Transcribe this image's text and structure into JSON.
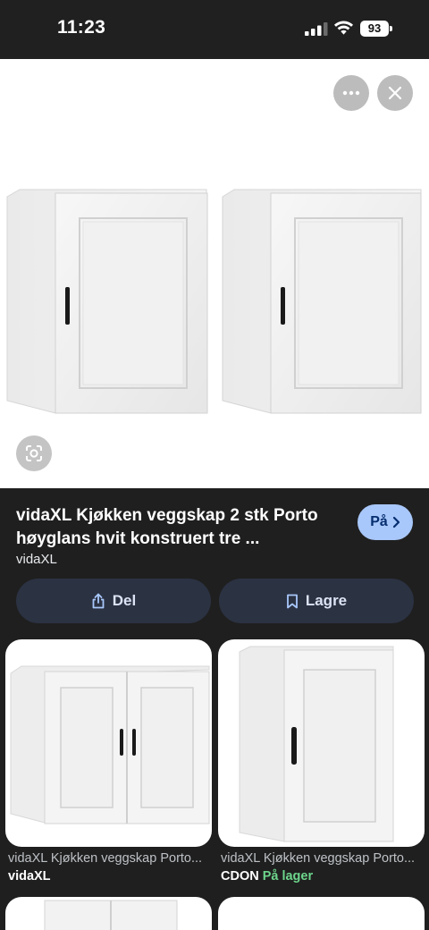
{
  "status_bar": {
    "time": "11:23",
    "battery": "93"
  },
  "hero": {
    "more_icon": "more-horiz-icon",
    "close_icon": "close-icon",
    "lens_icon": "lens-icon"
  },
  "product": {
    "title_line1": "vidaXL Kjøkken veggskap 2 stk Porto",
    "title_line2": "høyglans hvit konstruert tre ...",
    "source": "vidaXL",
    "visit_label": "På"
  },
  "actions": {
    "share_label": "Del",
    "save_label": "Lagre"
  },
  "related": [
    {
      "title": "vidaXL Kjøkken veggskap Porto...",
      "seller": "vidaXL",
      "stock": ""
    },
    {
      "title": "vidaXL Kjøkken veggskap Porto...",
      "seller": "CDON",
      "stock": "På lager"
    }
  ],
  "colors": {
    "accent": "#a8c7fa",
    "in_stock": "#6dd58c",
    "background": "#1f1f1f"
  }
}
